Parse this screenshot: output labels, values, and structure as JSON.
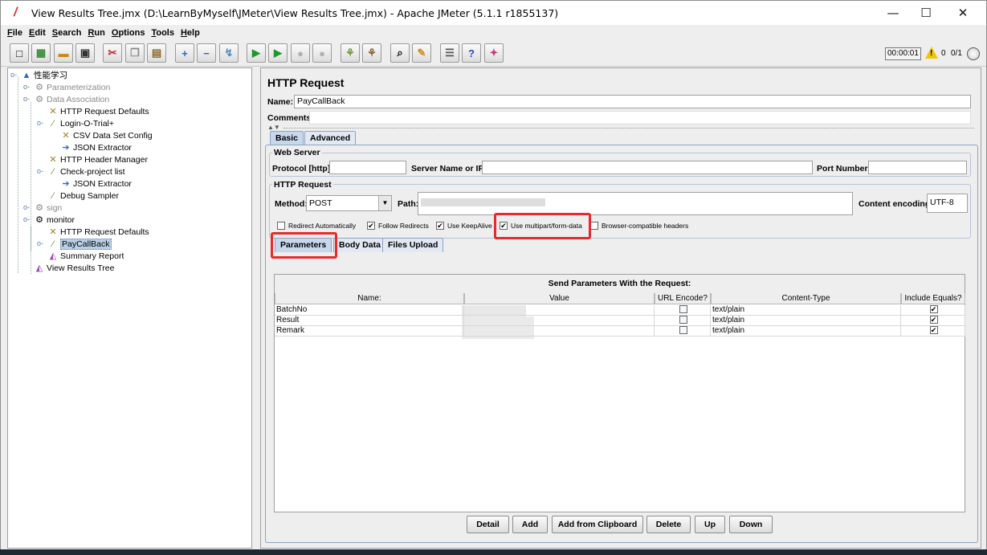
{
  "window": {
    "title": "View Results Tree.jmx (D:\\LearnByMyself\\JMeter\\View Results Tree.jmx) - Apache JMeter (5.1.1 r1855137)",
    "minimize": "—",
    "maximize": "☐",
    "close": "✕"
  },
  "menu": [
    "File",
    "Edit",
    "Search",
    "Run",
    "Options",
    "Tools",
    "Help"
  ],
  "toolbar": {
    "timer": "00:00:01",
    "warn_count": "0",
    "threads": "0/1"
  },
  "tree": [
    {
      "label": "性能学习",
      "icon": "test-plan-icon",
      "dim": false
    },
    {
      "label": "Parameterization",
      "icon": "gear-icon",
      "dim": true
    },
    {
      "label": "Data Association",
      "icon": "gear-icon",
      "dim": true
    },
    {
      "label": "HTTP Request Defaults",
      "icon": "config-icon",
      "dim": false
    },
    {
      "label": "Login-O-Trial+",
      "icon": "sampler-icon",
      "dim": false
    },
    {
      "label": "CSV Data Set Config",
      "icon": "config-icon",
      "dim": false
    },
    {
      "label": "JSON Extractor",
      "icon": "extractor-icon",
      "dim": false
    },
    {
      "label": "HTTP Header Manager",
      "icon": "config-icon",
      "dim": false
    },
    {
      "label": "Check-project list",
      "icon": "sampler-icon",
      "dim": false
    },
    {
      "label": "JSON Extractor",
      "icon": "extractor-icon",
      "dim": false
    },
    {
      "label": "Debug Sampler",
      "icon": "sampler-icon",
      "dim": false
    },
    {
      "label": "sign",
      "icon": "gear-icon",
      "dim": true
    },
    {
      "label": "monitor",
      "icon": "gear-icon",
      "dim": false
    },
    {
      "label": "HTTP Request Defaults",
      "icon": "config-icon",
      "dim": false
    },
    {
      "label": "PayCallBack",
      "icon": "sampler-icon",
      "dim": false,
      "selected": true
    },
    {
      "label": "Summary Report",
      "icon": "listener-icon",
      "dim": false
    },
    {
      "label": "View Results Tree",
      "icon": "listener-icon",
      "dim": false
    }
  ],
  "editor": {
    "title": "HTTP Request",
    "name_label": "Name:",
    "name_value": "PayCallBack",
    "comments_label": "Comments:",
    "tabs": [
      "Basic",
      "Advanced"
    ],
    "web_server": {
      "legend": "Web Server",
      "protocol_label": "Protocol [http]:",
      "server_label": "Server Name or IP:",
      "port_label": "Port Number:"
    },
    "http_request": {
      "legend": "HTTP Request",
      "method_label": "Method:",
      "method_value": "POST",
      "path_label": "Path:",
      "encoding_label": "Content encoding:",
      "encoding_value": "UTF-8"
    },
    "options": [
      {
        "label": "Redirect Automatically",
        "checked": false
      },
      {
        "label": "Follow Redirects",
        "checked": true
      },
      {
        "label": "Use KeepAlive",
        "checked": true
      },
      {
        "label": "Use multipart/form-data",
        "checked": true
      },
      {
        "label": "Browser-compatible headers",
        "checked": false
      }
    ],
    "subtabs": [
      "Parameters",
      "Body Data",
      "Files Upload"
    ],
    "params": {
      "title": "Send Parameters With the Request:",
      "columns": [
        "Name:",
        "Value",
        "URL Encode?",
        "Content-Type",
        "Include Equals?"
      ],
      "rows": [
        {
          "name": "BatchNo",
          "value": "",
          "url_encode": false,
          "content_type": "text/plain",
          "include_equals": true
        },
        {
          "name": "Result",
          "value": "",
          "url_encode": false,
          "content_type": "text/plain",
          "include_equals": true
        },
        {
          "name": "Remark",
          "value": "",
          "url_encode": false,
          "content_type": "text/plain",
          "include_equals": true
        }
      ]
    },
    "buttons": [
      "Detail",
      "Add",
      "Add from Clipboard",
      "Delete",
      "Up",
      "Down"
    ]
  }
}
